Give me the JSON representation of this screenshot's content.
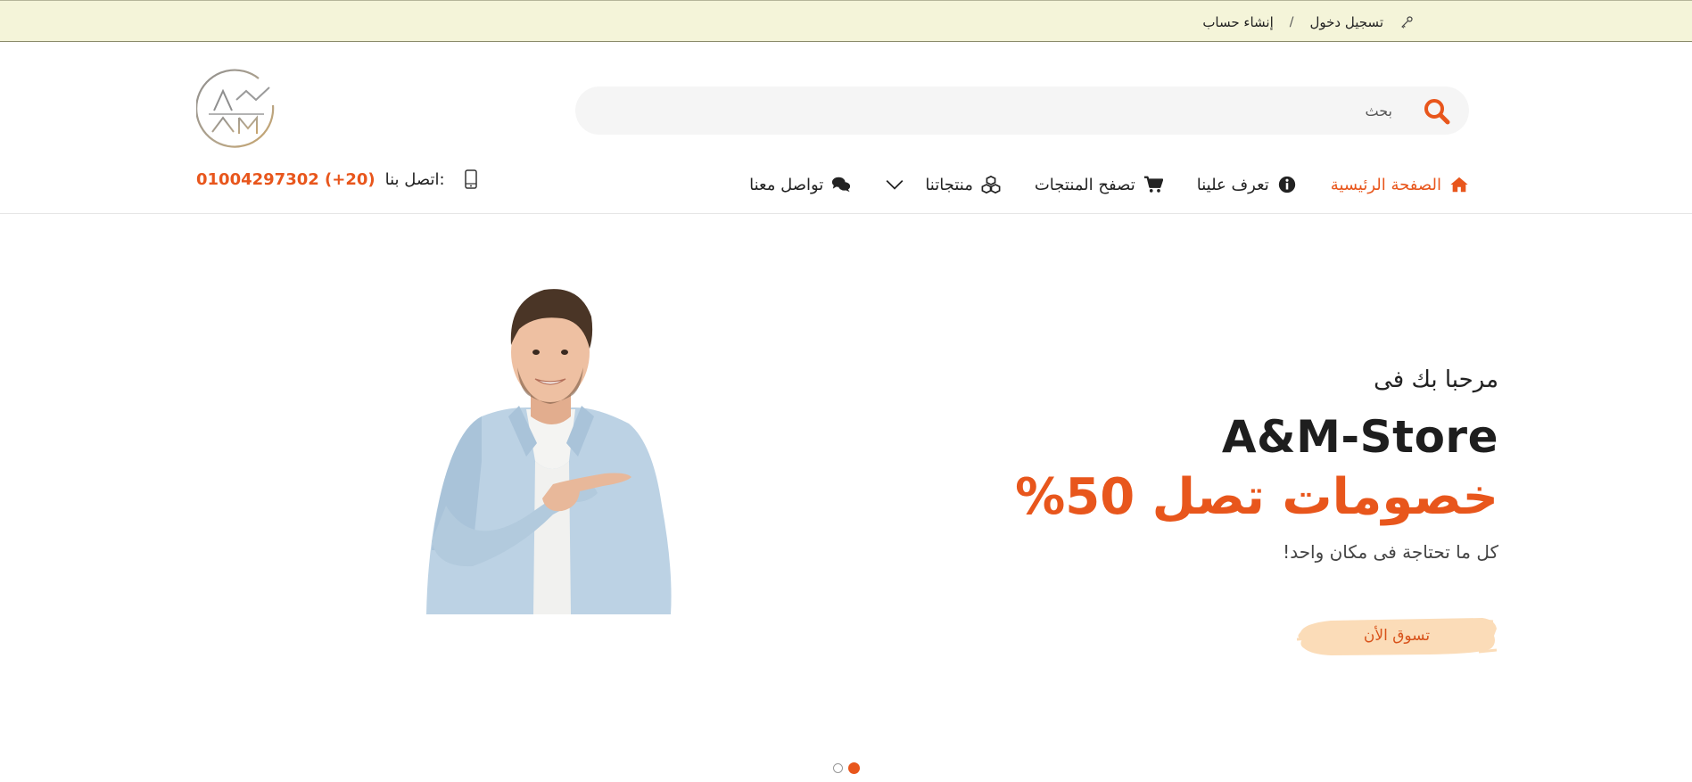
{
  "topbar": {
    "login_label": "تسجيل دخول",
    "separator": "/",
    "signup_label": "إنشاء حساب",
    "login_icon": "key-icon"
  },
  "header": {
    "logo_text": "AM",
    "search": {
      "placeholder": "بحث",
      "icon": "search-icon"
    },
    "nav": [
      {
        "label": "الصفحة الرئيسية",
        "icon": "home-icon",
        "active": true
      },
      {
        "label": "تعرف علينا",
        "icon": "info-icon",
        "active": false
      },
      {
        "label": "تصفح المنتجات",
        "icon": "cart-icon",
        "active": false
      },
      {
        "label": "منتجاتنا",
        "icon": "cubes-icon",
        "active": false
      },
      {
        "label": "تواصل معنا",
        "icon": "chat-icon",
        "active": false
      }
    ],
    "contact": {
      "label": "اتصل بنا:",
      "phone": "01004297302 (+20)",
      "icon": "mobile-icon"
    }
  },
  "hero": {
    "welcome": "مرحبا بك فى",
    "brand": "A&M-Store",
    "discount": "خصومات تصل 50%",
    "tagline": "كل ما تحتاجة فى مكان واحد!",
    "cta_label": "تسوق الأن",
    "slides_total": 2,
    "active_slide": 1
  },
  "colors": {
    "accent": "#e8561c",
    "topbar_bg": "#f4f4d9",
    "cta_brush": "#fbdcb8",
    "search_bg": "#f5f5f5"
  }
}
